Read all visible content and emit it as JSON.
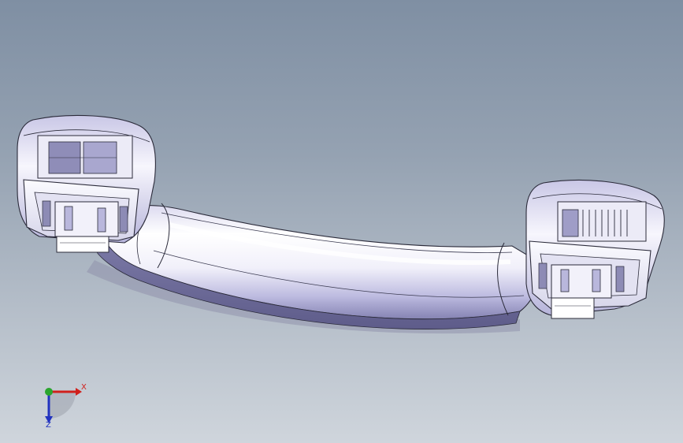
{
  "viewport": {
    "background_top": "#7f8fa3",
    "background_bottom": "#cfd5dc"
  },
  "model": {
    "part": "telephone-handset",
    "body_color": "#f4f3fb",
    "shade_color": "#9d9cc4",
    "edge_color": "#2b2b3a"
  },
  "triad": {
    "x_label": "X",
    "z_label": "Z",
    "x_color": "#d0201c",
    "y_color": "#2aa52e",
    "z_color": "#2233c0"
  }
}
